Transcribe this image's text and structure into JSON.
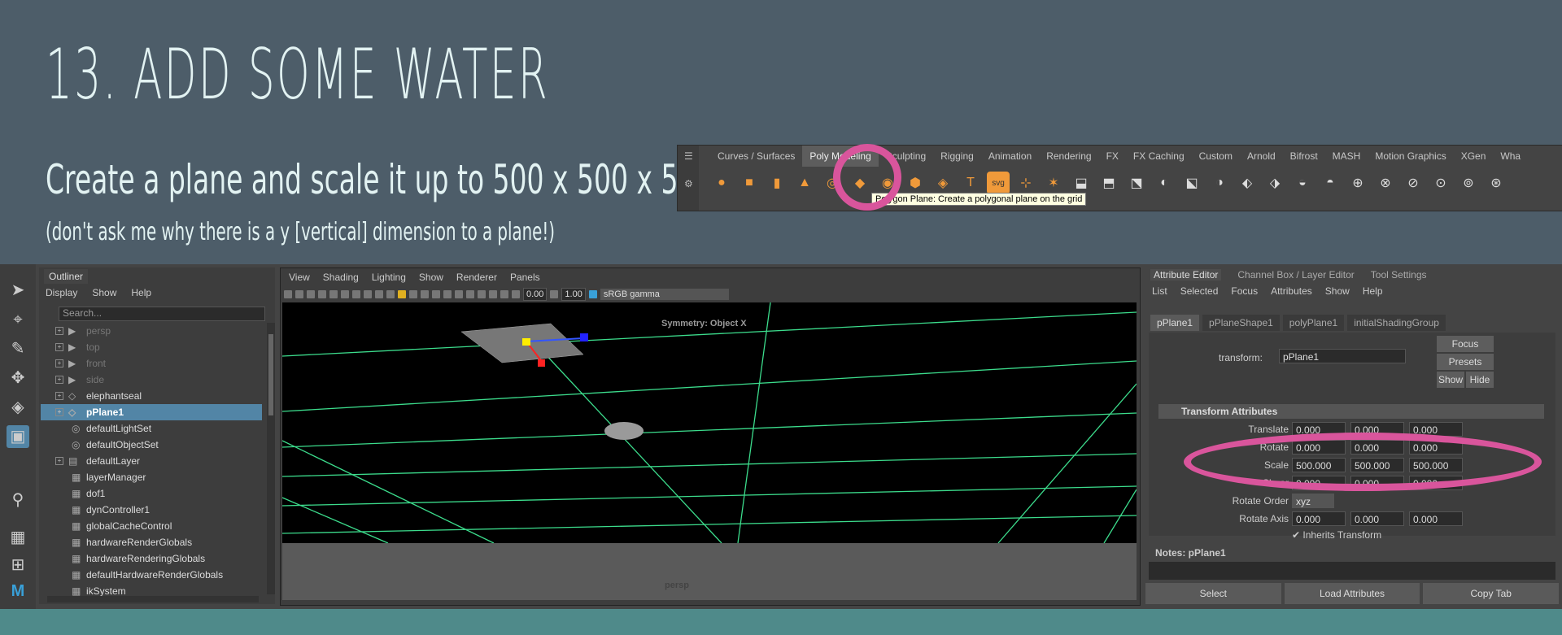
{
  "slide": {
    "heading": "13. ADD SOME WATER",
    "subtitle": "Create a plane and scale it up to 500 x 500 x 500",
    "note": "(don't ask me why there is a y [vertical] dimension to a plane!)"
  },
  "shelf": {
    "tabs": [
      "Curves / Surfaces",
      "Poly Modeling",
      "Sculpting",
      "Rigging",
      "Animation",
      "Rendering",
      "FX",
      "FX Caching",
      "Custom",
      "Arnold",
      "Bifrost",
      "MASH",
      "Motion Graphics",
      "XGen",
      "Wha"
    ],
    "active_tab": "Poly Modeling",
    "tooltip": "Polygon Plane: Create a polygonal plane on the grid",
    "icons": [
      "sphere-icon",
      "cube-icon",
      "cylinder-icon",
      "cone-icon",
      "torus-icon",
      "plane-icon",
      "disc-icon",
      "platonic-icon",
      "superellipse-icon",
      "text-icon",
      "svg-icon",
      "sweep-icon",
      "type-icon",
      "combine-icon",
      "separate-icon",
      "extract-icon",
      "smooth-icon",
      "boolean-icon",
      "average-icon",
      "bridge-icon",
      "extrude-icon",
      "bevel-icon",
      "merge-icon",
      "fill-hole-icon",
      "target-weld-icon",
      "knife-icon",
      "append-icon",
      "mirror-icon",
      "bend-icon"
    ],
    "svg_label": "svg",
    "text_label": "T"
  },
  "outliner": {
    "title": "Outliner",
    "menu": [
      "Display",
      "Show",
      "Help"
    ],
    "search_placeholder": "Search...",
    "items": [
      {
        "label": "persp",
        "icon": "camera-icon",
        "dim": true,
        "exp": true
      },
      {
        "label": "top",
        "icon": "camera-icon",
        "dim": true,
        "exp": true
      },
      {
        "label": "front",
        "icon": "camera-icon",
        "dim": true,
        "exp": true
      },
      {
        "label": "side",
        "icon": "camera-icon",
        "dim": true,
        "exp": true
      },
      {
        "label": "elephantseal",
        "icon": "mesh-icon",
        "dim": false,
        "exp": true
      },
      {
        "label": "pPlane1",
        "icon": "mesh-icon",
        "dim": false,
        "exp": true,
        "sel": true
      },
      {
        "label": "defaultLightSet",
        "icon": "set-icon",
        "dim": false,
        "exp": false
      },
      {
        "label": "defaultObjectSet",
        "icon": "set-icon",
        "dim": false,
        "exp": false
      },
      {
        "label": "defaultLayer",
        "icon": "layer-icon",
        "dim": false,
        "exp": true
      },
      {
        "label": "layerManager",
        "icon": "node-icon",
        "dim": false,
        "exp": false
      },
      {
        "label": "dof1",
        "icon": "node-icon",
        "dim": false,
        "exp": false
      },
      {
        "label": "dynController1",
        "icon": "node-icon",
        "dim": false,
        "exp": false
      },
      {
        "label": "globalCacheControl",
        "icon": "node-icon",
        "dim": false,
        "exp": false
      },
      {
        "label": "hardwareRenderGlobals",
        "icon": "node-icon",
        "dim": false,
        "exp": false
      },
      {
        "label": "hardwareRenderingGlobals",
        "icon": "node-icon",
        "dim": false,
        "exp": false
      },
      {
        "label": "defaultHardwareRenderGlobals",
        "icon": "node-icon",
        "dim": false,
        "exp": false
      },
      {
        "label": "ikSystem",
        "icon": "node-icon",
        "dim": false,
        "exp": false
      }
    ]
  },
  "viewport": {
    "menu": [
      "View",
      "Shading",
      "Lighting",
      "Show",
      "Renderer",
      "Panels"
    ],
    "exposure": "0.00",
    "gamma": "1.00",
    "color_space": "sRGB gamma",
    "symmetry_label": "Symmetry: Object X",
    "camera_label": "persp"
  },
  "attribute_editor": {
    "tabs": [
      "Attribute Editor",
      "Channel Box / Layer Editor",
      "Tool Settings"
    ],
    "menu": [
      "List",
      "Selected",
      "Focus",
      "Attributes",
      "Show",
      "Help"
    ],
    "node_tabs": [
      "pPlane1",
      "pPlaneShape1",
      "polyPlane1",
      "initialShadingGroup"
    ],
    "transform_label": "transform:",
    "transform_value": "pPlane1",
    "focus_btn": "Focus",
    "presets_btn": "Presets",
    "show_btn": "Show",
    "hide_btn": "Hide",
    "section": "Transform Attributes",
    "translate_label": "Translate",
    "translate": [
      "0.000",
      "0.000",
      "0.000"
    ],
    "rotate_label": "Rotate",
    "rotate": [
      "0.000",
      "0.000",
      "0.000"
    ],
    "scale_label": "Scale",
    "scale": [
      "500.000",
      "500.000",
      "500.000"
    ],
    "shear_label": "Shear",
    "shear": [
      "0.000",
      "0.000",
      "0.000"
    ],
    "rotate_order_label": "Rotate Order",
    "rotate_order": "xyz",
    "rotate_axis_label": "Rotate Axis",
    "rotate_axis": [
      "0.000",
      "0.000",
      "0.000"
    ],
    "inherits_label": "Inherits Transform",
    "notes_label": "Notes:  pPlane1",
    "bottom_buttons": [
      "Select",
      "Load Attributes",
      "Copy Tab"
    ]
  },
  "colors": {
    "highlight": "#d9559c",
    "selection": "#5285a6",
    "shelf_icon": "#f09a3a",
    "grid": "#3cdc8c"
  }
}
